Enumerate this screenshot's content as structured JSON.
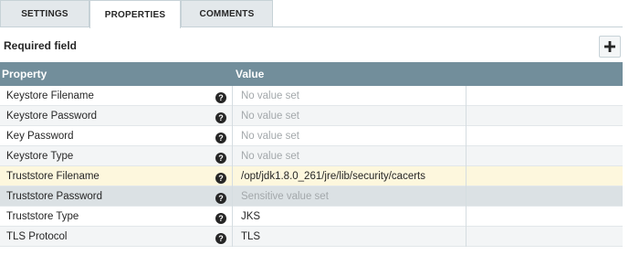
{
  "tabs": [
    {
      "label": "SETTINGS",
      "active": false
    },
    {
      "label": "PROPERTIES",
      "active": true
    },
    {
      "label": "COMMENTS",
      "active": false
    }
  ],
  "required_label": "Required field",
  "add_button_icon": "plus-icon",
  "table": {
    "headers": {
      "property": "Property",
      "value": "Value"
    },
    "rows": [
      {
        "name": "Keystore Filename",
        "value": "No value set",
        "value_set": false
      },
      {
        "name": "Keystore Password",
        "value": "No value set",
        "value_set": false
      },
      {
        "name": "Key Password",
        "value": "No value set",
        "value_set": false
      },
      {
        "name": "Keystore Type",
        "value": "No value set",
        "value_set": false
      },
      {
        "name": "Truststore Filename",
        "value": "/opt/jdk1.8.0_261/jre/lib/security/cacerts",
        "value_set": true,
        "highlighted": true
      },
      {
        "name": "Truststore Password",
        "value": "Sensitive value set",
        "value_set": false,
        "selected": true
      },
      {
        "name": "Truststore Type",
        "value": "JKS",
        "value_set": true
      },
      {
        "name": "TLS Protocol",
        "value": "TLS",
        "value_set": true
      }
    ]
  },
  "colors": {
    "header_bg": "#728e9b",
    "highlight_row": "#fdf7dd",
    "selected_row": "#dbe1e4",
    "placeholder_text": "#a3a8ab"
  }
}
